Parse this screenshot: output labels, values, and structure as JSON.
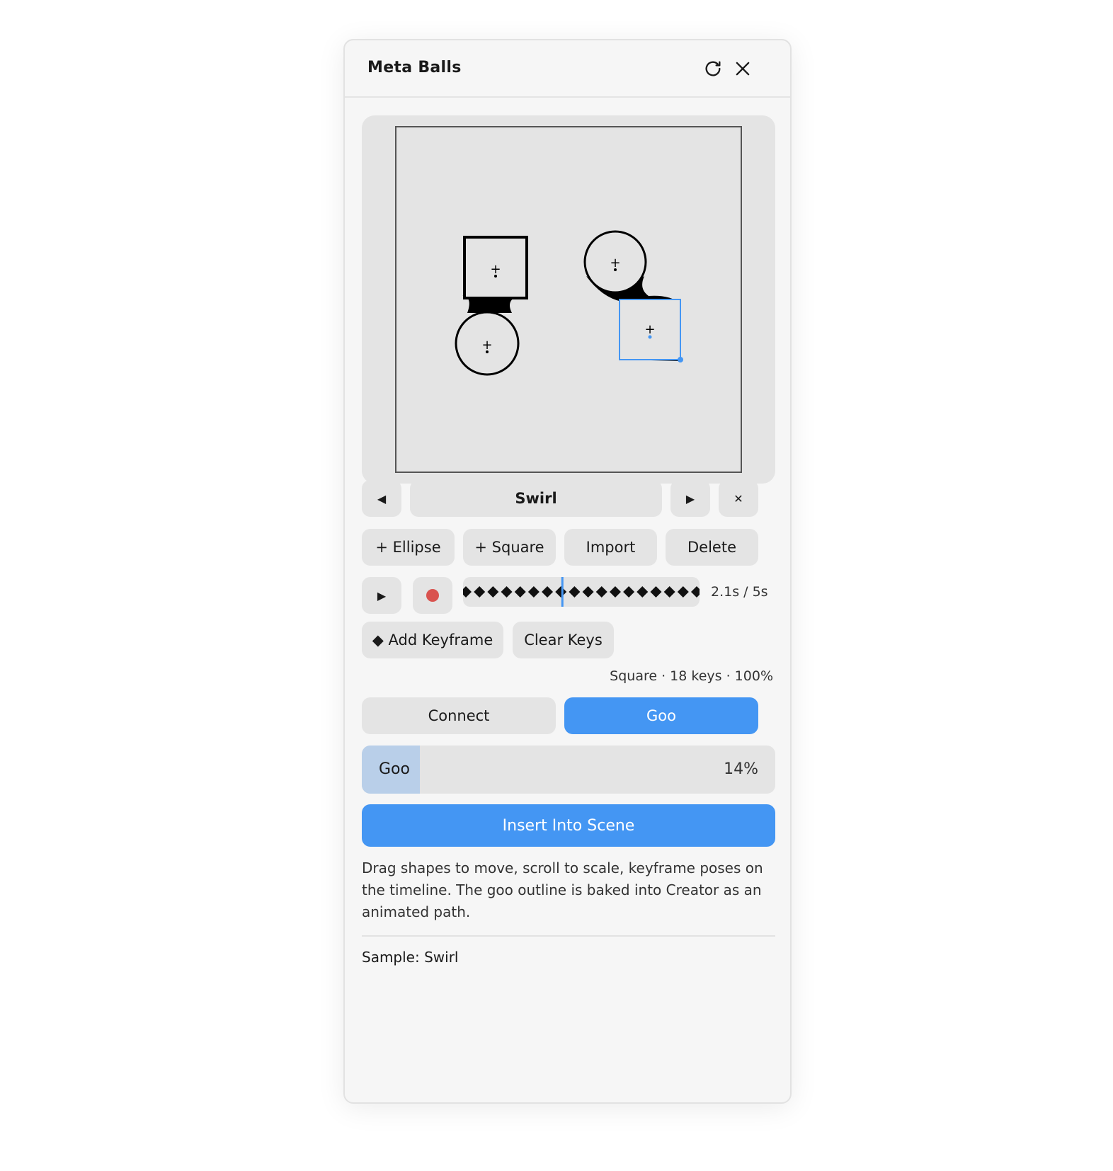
{
  "window": {
    "title": "Meta Balls"
  },
  "sample_nav": {
    "prev_label": "◀",
    "sample_name": "Swirl",
    "next_label": "▶",
    "close_label": "✕"
  },
  "shape_actions": {
    "add_ellipse": "+ Ellipse",
    "add_square": "+ Square",
    "import": "Import",
    "delete": "Delete"
  },
  "playback": {
    "play_label": "▶",
    "keyframe_count": 18,
    "playhead_fraction": 0.42,
    "time_label": "2.1s / 5s"
  },
  "keyframes": {
    "add_label": "◆ Add Keyframe",
    "clear_label": "Clear Keys"
  },
  "selection_info": "Square · 18 keys · 100%",
  "mode": {
    "connect_label": "Connect",
    "goo_label": "Goo",
    "active": "Goo"
  },
  "goo_slider": {
    "label": "Goo",
    "value_text": "14%",
    "value": 0.14
  },
  "insert_label": "Insert Into Scene",
  "description": "Drag shapes to move, scroll to scale, keyframe poses on the timeline. The goo outline is baked into Creator as an animated path.",
  "footer": {
    "sample_label": "Sample: Swirl"
  },
  "colors": {
    "accent": "#4496f3",
    "record": "#d9534f",
    "slider_fill": "#b9cfe9",
    "panel_bg": "#f6f6f6"
  },
  "icons": [
    "refresh-icon",
    "close-icon",
    "play-icon",
    "record-icon",
    "diamond-icon"
  ]
}
